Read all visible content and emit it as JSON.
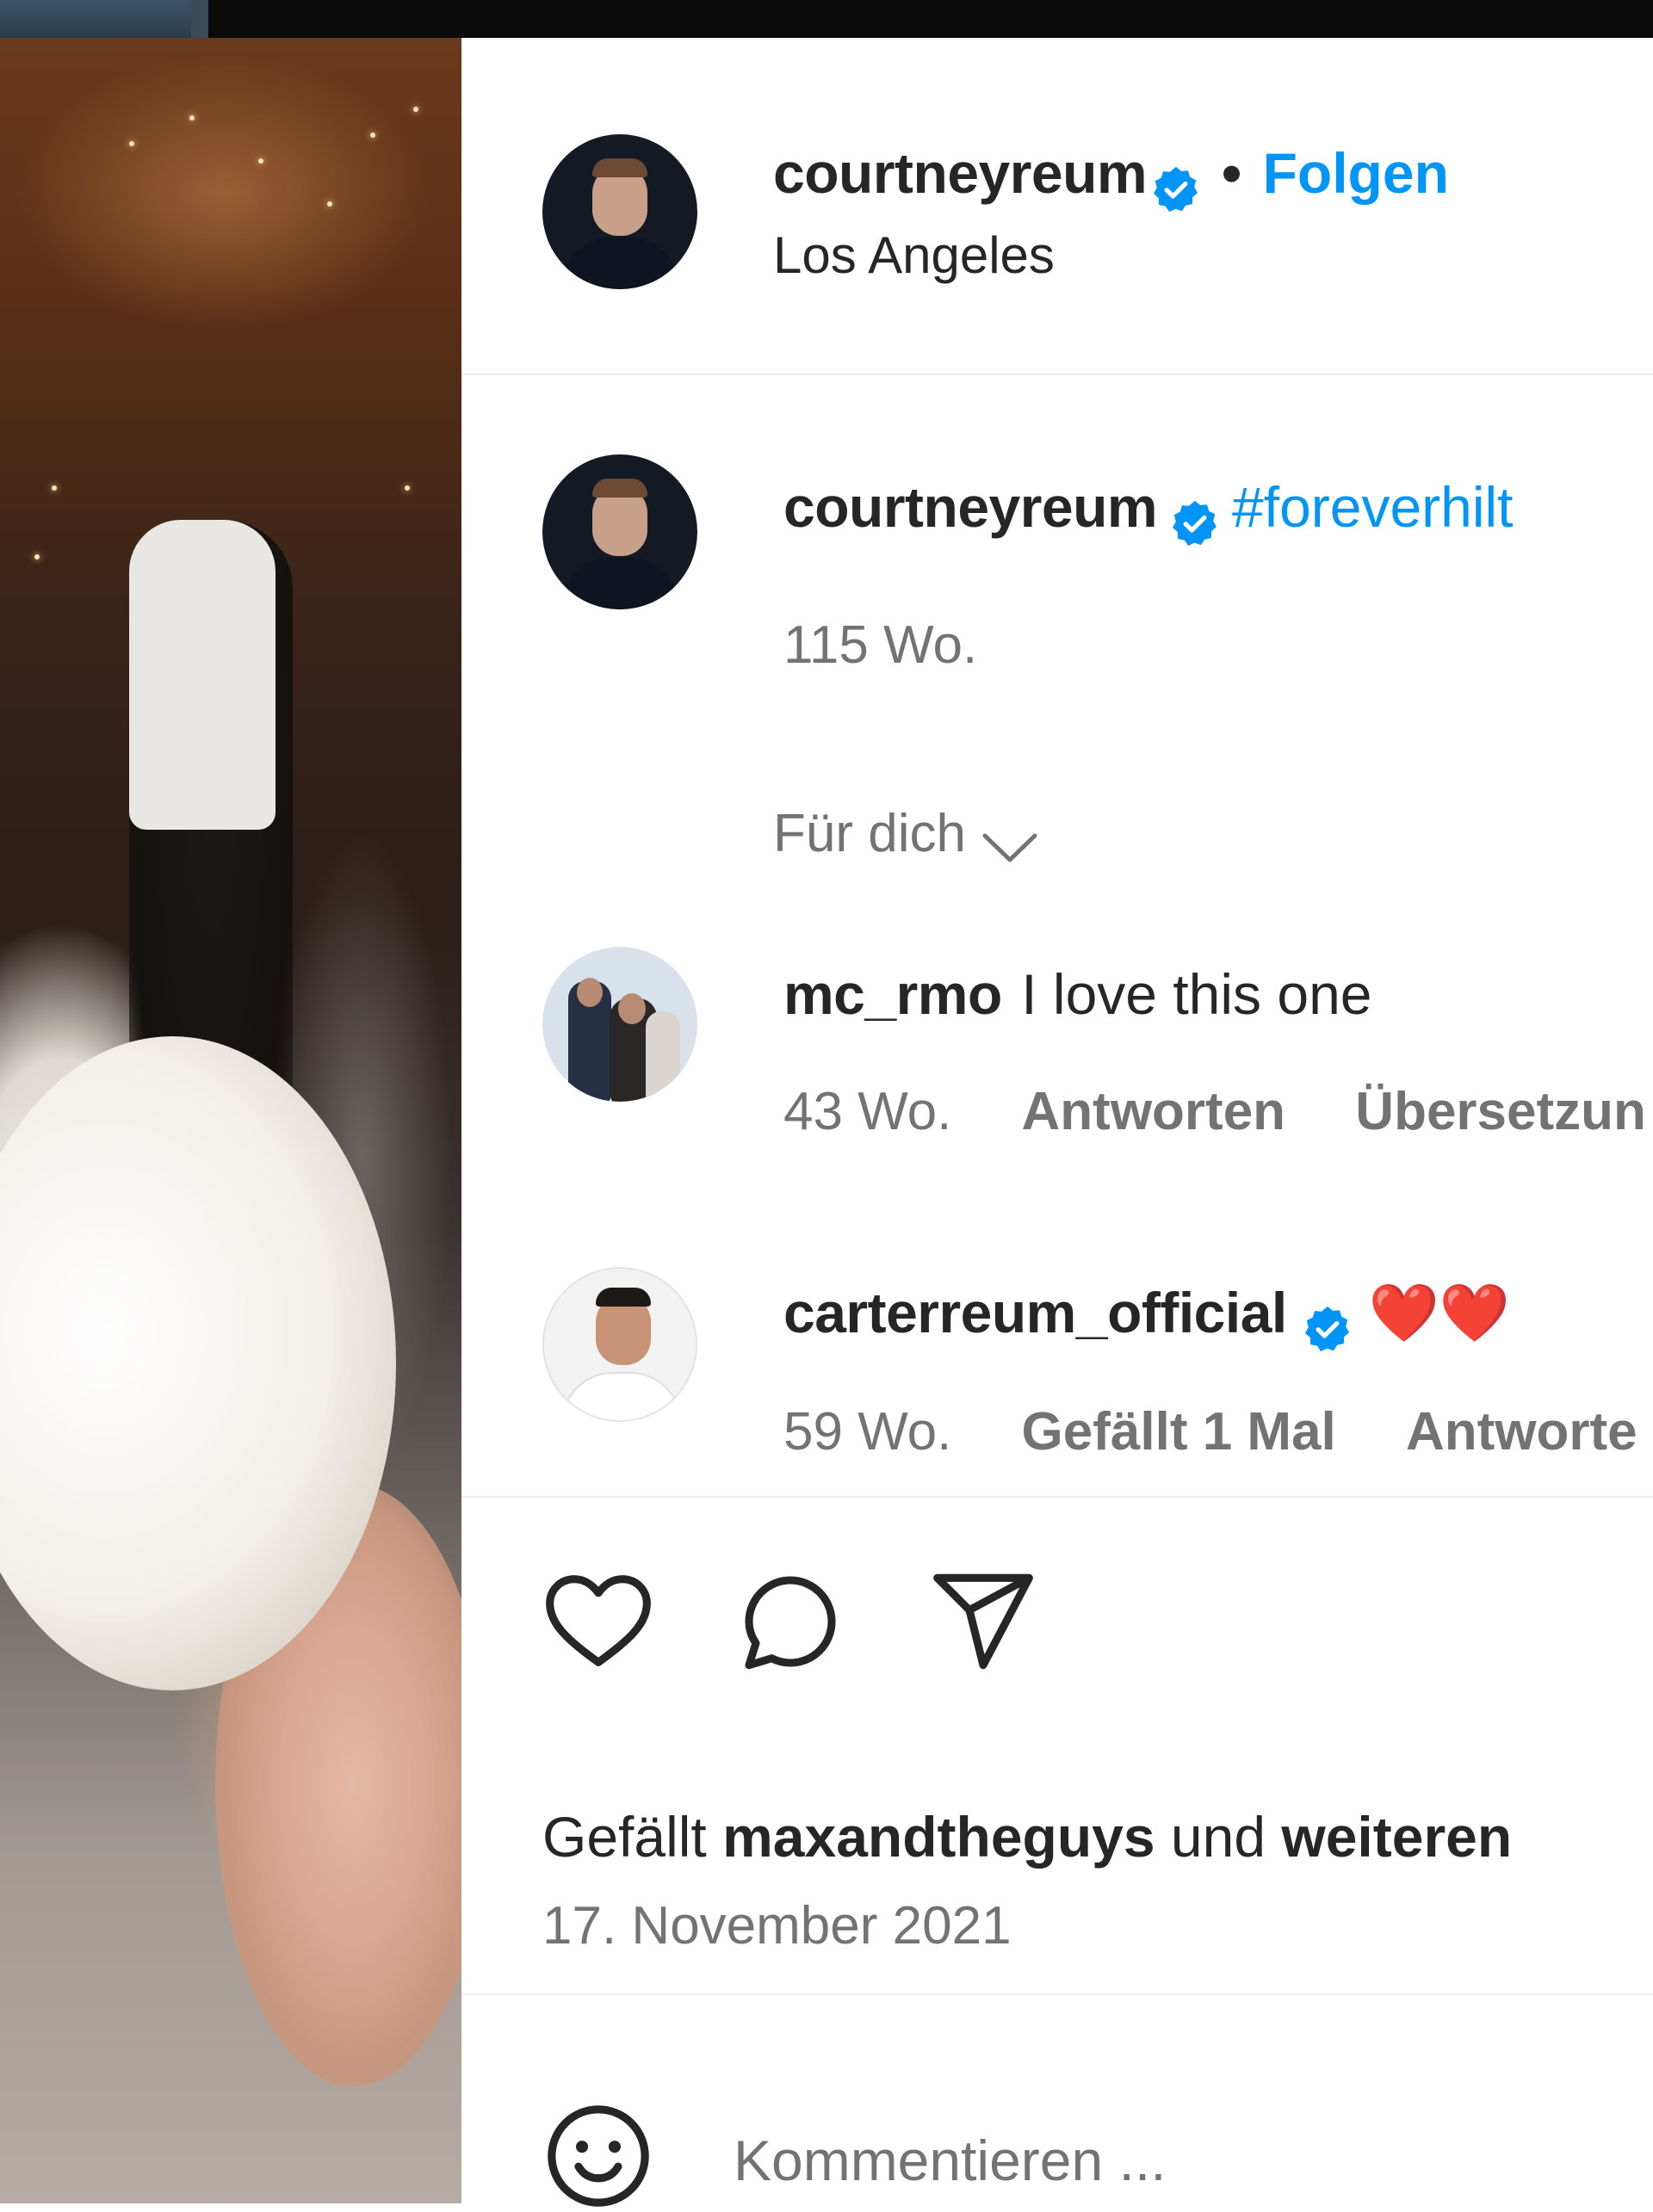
{
  "post": {
    "header": {
      "username": "courtneyreum",
      "separator": "•",
      "follow_label": "Folgen",
      "location": "Los Angeles"
    },
    "caption": {
      "username": "courtneyreum",
      "text": "#foreverhilt",
      "age": "115 Wo."
    },
    "sort_label": "Für dich",
    "comments": [
      {
        "username": "mc_rmo",
        "text": "I love this one",
        "age": "43 Wo.",
        "actions": [
          "Antworten",
          "Übersetzun"
        ]
      },
      {
        "username": "carterreum_official",
        "text": "❤️❤️",
        "age": "59 Wo.",
        "actions": [
          "Gefällt 1 Mal",
          "Antworte"
        ]
      }
    ],
    "likes": {
      "prefix": "Gefällt",
      "user": "maxandtheguys",
      "middle": "und",
      "suffix": "weiteren"
    },
    "date": "17. November 2021",
    "comment_input": {
      "placeholder": "Kommentieren ..."
    },
    "icons": {
      "like": "heart-icon",
      "comment": "comment-icon",
      "share": "send-icon",
      "emoji": "emoji-icon",
      "verified": "verified-badge-icon"
    },
    "colors": {
      "link_blue": "#0095f6",
      "text_dark": "#262626",
      "text_muted": "#737373",
      "heart_red": "#e0141e"
    }
  }
}
